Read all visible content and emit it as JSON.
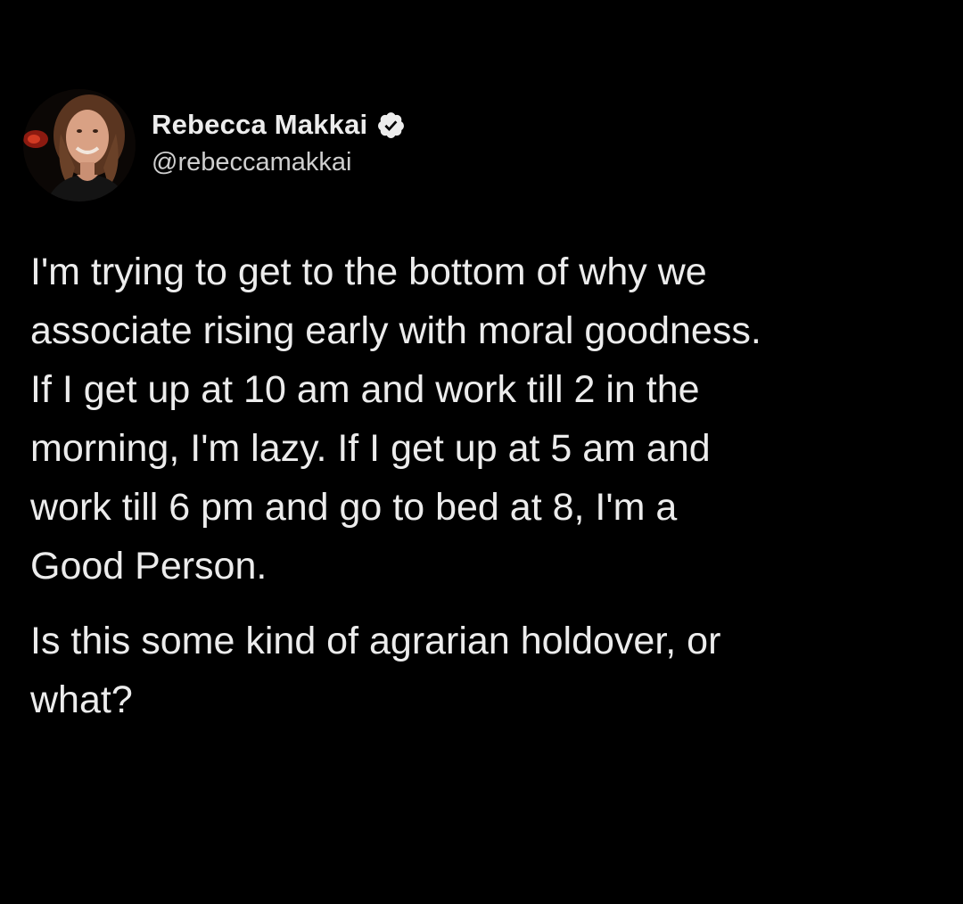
{
  "author": {
    "display_name": "Rebecca Makkai",
    "handle": "@rebeccamakkai",
    "verified": true,
    "verified_icon": "verified-badge-icon"
  },
  "tweet": {
    "paragraph_1": "I'm trying to get to the bottom of why we\nassociate rising early with moral goodness.\nIf I get up at 10 am and work till 2 in the\nmorning, I'm lazy. If I get up at 5 am and\nwork till 6 pm and go to bed at 8, I'm a\nGood Person.",
    "paragraph_2": "Is this some kind of agrarian holdover, or\nwhat?"
  },
  "colors": {
    "background": "#000000",
    "text": "#ececec",
    "handle_text": "#cfcfcf",
    "badge": "#ededed"
  }
}
